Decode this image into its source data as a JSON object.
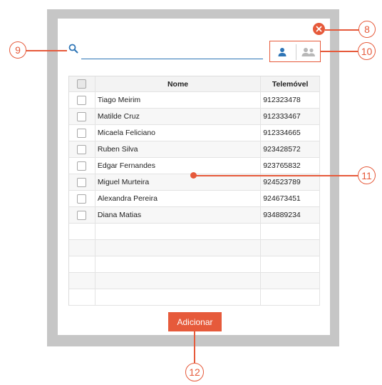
{
  "search": {
    "value": "",
    "placeholder": ""
  },
  "view_toggle": {
    "single_icon": "person-icon",
    "group_icon": "group-icon",
    "active": "single"
  },
  "table": {
    "columns": [
      "",
      "Nome",
      "Telemóvel"
    ],
    "rows": [
      {
        "name": "Tiago Meirim",
        "phone": "912323478"
      },
      {
        "name": "Matilde Cruz",
        "phone": "912333467"
      },
      {
        "name": "Micaela Feliciano",
        "phone": "912334665"
      },
      {
        "name": "Ruben Silva",
        "phone": "923428572"
      },
      {
        "name": "Edgar Fernandes",
        "phone": "923765832"
      },
      {
        "name": "Miguel Murteira",
        "phone": "924523789"
      },
      {
        "name": "Alexandra Pereira",
        "phone": "924673451"
      },
      {
        "name": "Diana Matias",
        "phone": "934889234"
      },
      {
        "name": "",
        "phone": ""
      },
      {
        "name": "",
        "phone": ""
      },
      {
        "name": "",
        "phone": ""
      },
      {
        "name": "",
        "phone": ""
      },
      {
        "name": "",
        "phone": ""
      }
    ]
  },
  "add_button": {
    "label": "Adicionar"
  },
  "callouts": {
    "close": "8",
    "search": "9",
    "toggle": "10",
    "table": "11",
    "add": "12"
  },
  "colors": {
    "accent": "#e65a3b",
    "link_blue": "#2e75b6",
    "frame_gray": "#c6c6c6"
  }
}
